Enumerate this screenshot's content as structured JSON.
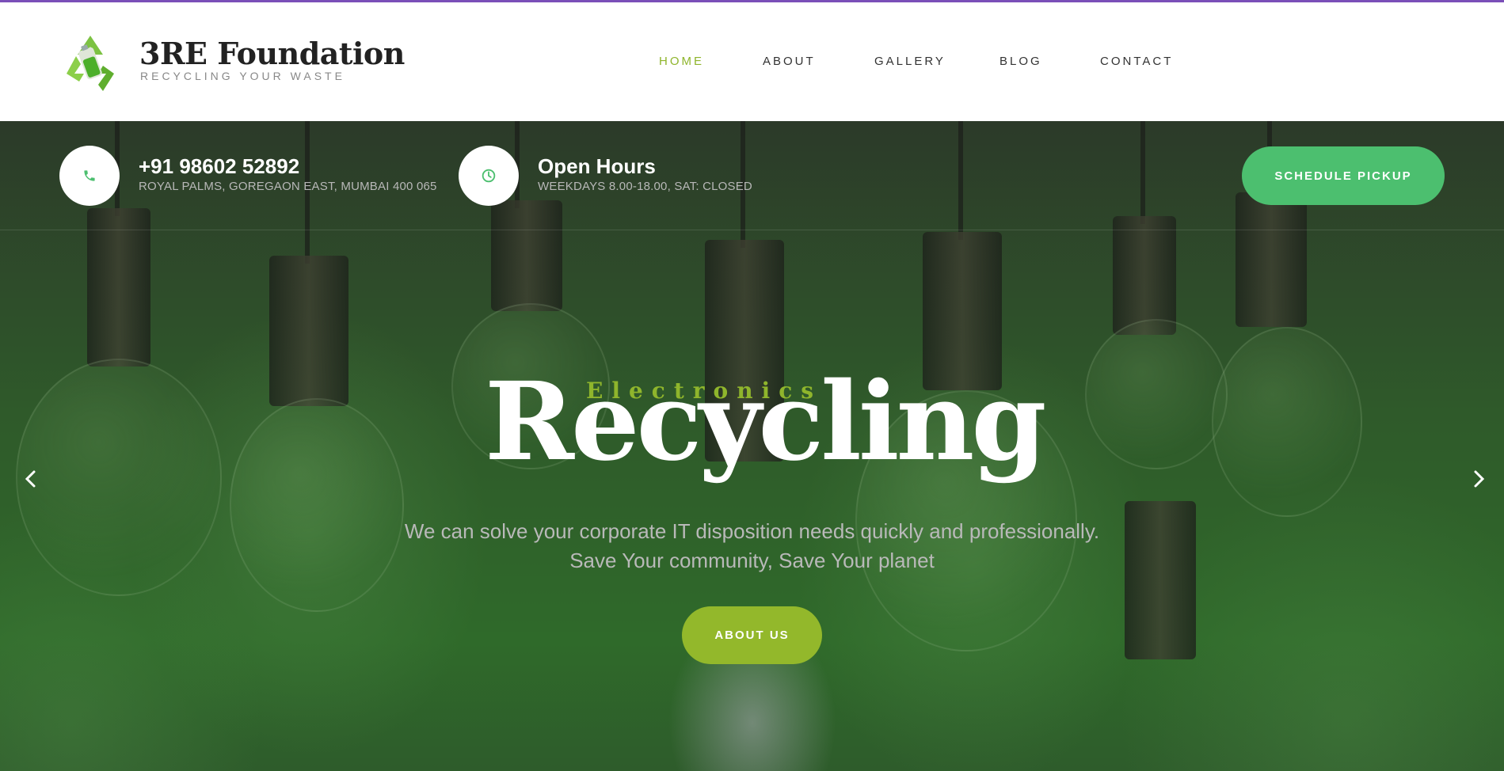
{
  "brand": {
    "title": "3RE Foundation",
    "subtitle": "RECYCLING YOUR WASTE"
  },
  "nav": {
    "items": [
      {
        "label": "HOME",
        "active": true
      },
      {
        "label": "ABOUT",
        "active": false
      },
      {
        "label": "GALLERY",
        "active": false
      },
      {
        "label": "BLOG",
        "active": false
      },
      {
        "label": "CONTACT",
        "active": false
      }
    ]
  },
  "contact": {
    "phone": "+91 98602 52892",
    "address": "ROYAL PALMS, GOREGAON EAST, MUMBAI 400 065"
  },
  "hours": {
    "title": "Open Hours",
    "detail": "WEEKDAYS 8.00-18.00, SAT: CLOSED"
  },
  "schedule_button": "SCHEDULE PICKUP",
  "hero": {
    "kicker": "Electronics",
    "headline": "Recycling",
    "line1": "We can solve your corporate IT disposition needs quickly and professionally.",
    "line2": "Save Your community, Save Your planet",
    "button": "ABOUT US"
  },
  "icons": {
    "logo": "recycle-battery-logo",
    "phone": "phone-icon",
    "clock": "clock-icon",
    "prev": "chevron-left-icon",
    "next": "chevron-right-icon"
  },
  "colors": {
    "accent_green": "#8fb52c",
    "schedule_green": "#4cbf6f",
    "about_green": "#93b82b",
    "top_line": "#7a4fb8"
  }
}
